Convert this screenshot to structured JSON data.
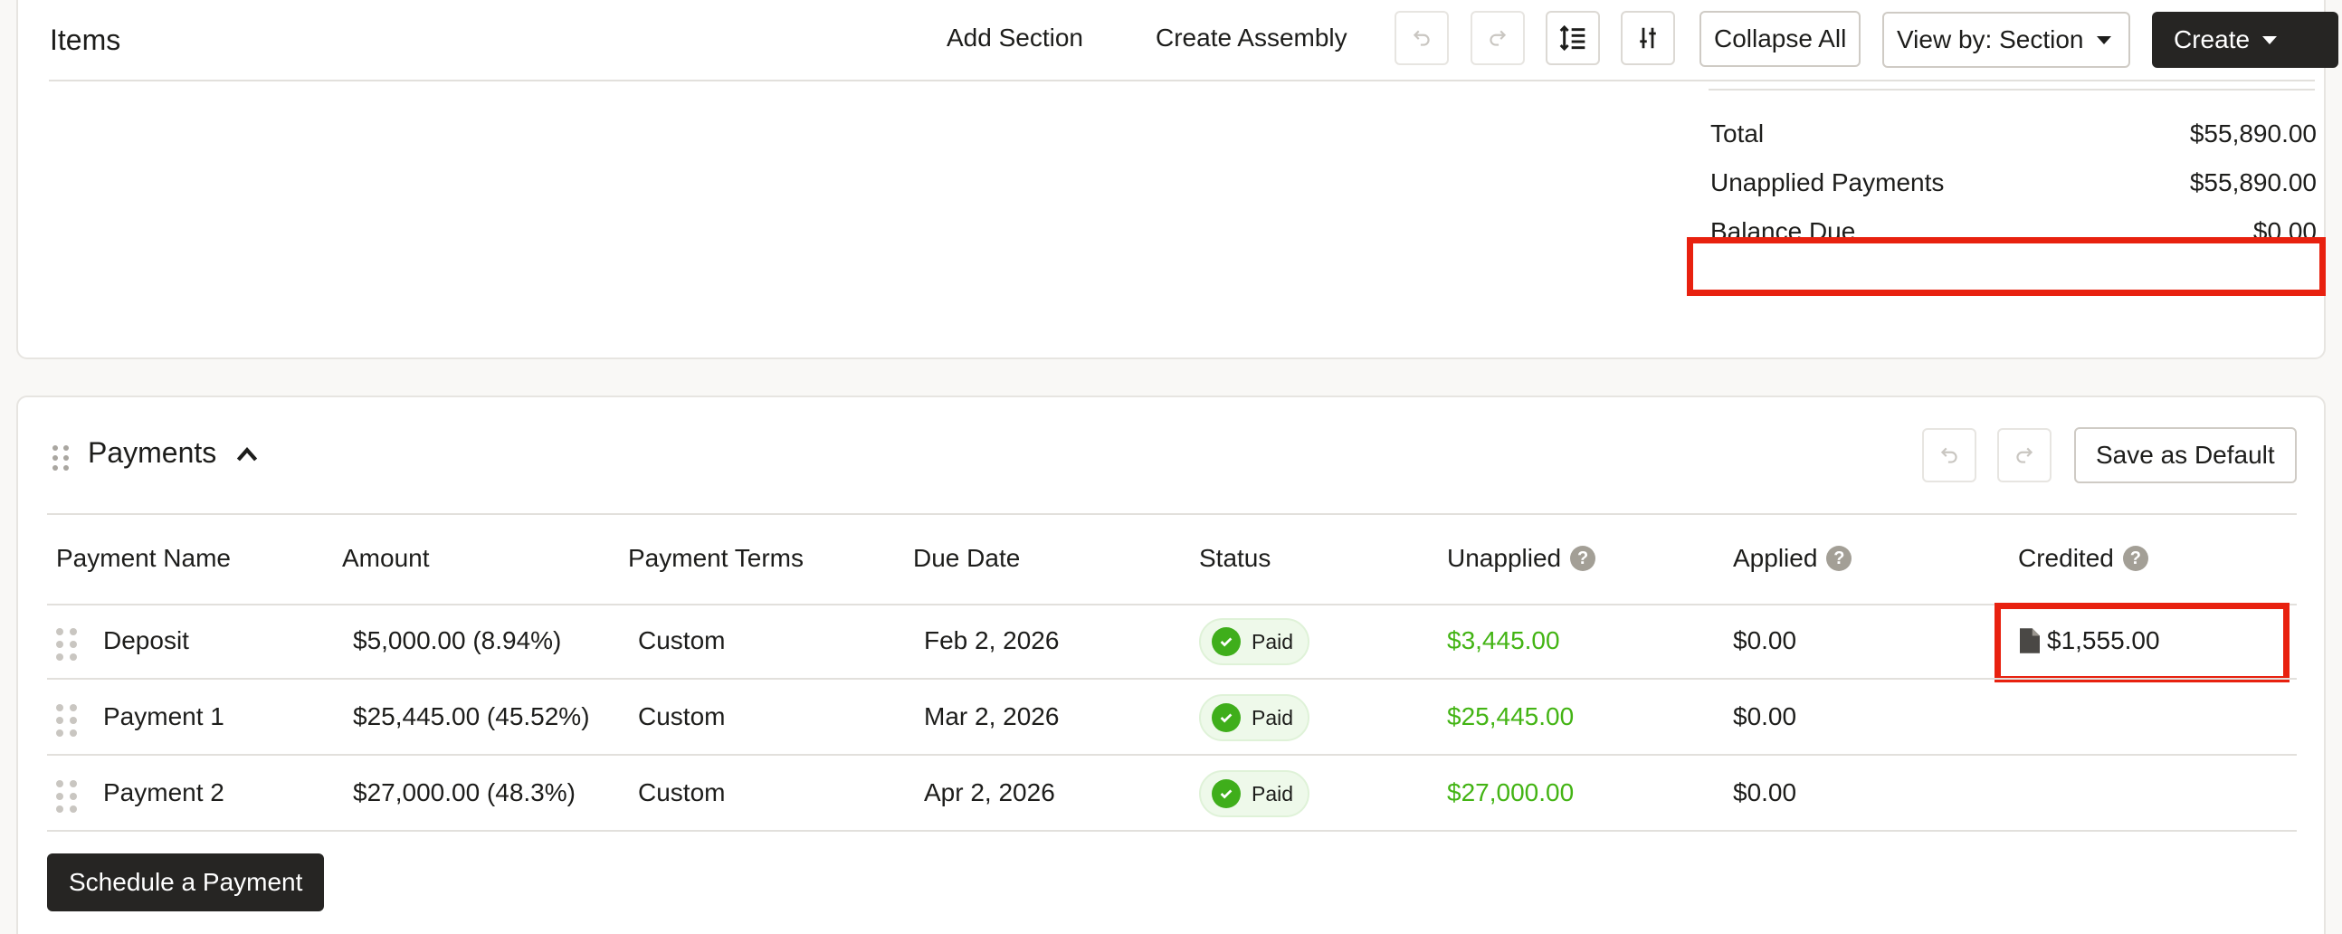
{
  "items": {
    "title": "Items",
    "add_section": "Add Section",
    "create_assembly": "Create Assembly",
    "collapse_all": "Collapse All",
    "view_by": "View by: Section",
    "create": "Create",
    "summary": [
      {
        "label": "Total",
        "value": "$55,890.00"
      },
      {
        "label": "Unapplied Payments",
        "value": "$55,890.00"
      },
      {
        "label": "Balance Due",
        "value": "$0.00"
      }
    ]
  },
  "payments": {
    "title": "Payments",
    "save_default": "Save as Default",
    "columns": [
      "Payment Name",
      "Amount",
      "Payment Terms",
      "Due Date",
      "Status",
      "Unapplied",
      "Applied",
      "Credited"
    ],
    "rows": [
      {
        "name": "Deposit",
        "amount": "$5,000.00 (8.94%)",
        "terms": "Custom",
        "due": "Feb 2, 2026",
        "status": "Paid",
        "unapplied": "$3,445.00",
        "applied": "$0.00",
        "credited": "$1,555.00"
      },
      {
        "name": "Payment 1",
        "amount": "$25,445.00 (45.52%)",
        "terms": "Custom",
        "due": "Mar 2, 2026",
        "status": "Paid",
        "unapplied": "$25,445.00",
        "applied": "$0.00",
        "credited": ""
      },
      {
        "name": "Payment 2",
        "amount": "$27,000.00 (48.3%)",
        "terms": "Custom",
        "due": "Apr 2, 2026",
        "status": "Paid",
        "unapplied": "$27,000.00",
        "applied": "$0.00",
        "credited": ""
      }
    ],
    "schedule": "Schedule a Payment"
  },
  "icons": [
    "undo-icon",
    "redo-icon",
    "line-spacing-icon",
    "sliders-icon",
    "chevron-up-icon",
    "check-circle-icon",
    "document-icon",
    "help-icon",
    "drag-handle-icon"
  ],
  "colors": {
    "accent_dark": "#262523",
    "paid_green": "#43b414",
    "highlight": "#e8210f"
  }
}
